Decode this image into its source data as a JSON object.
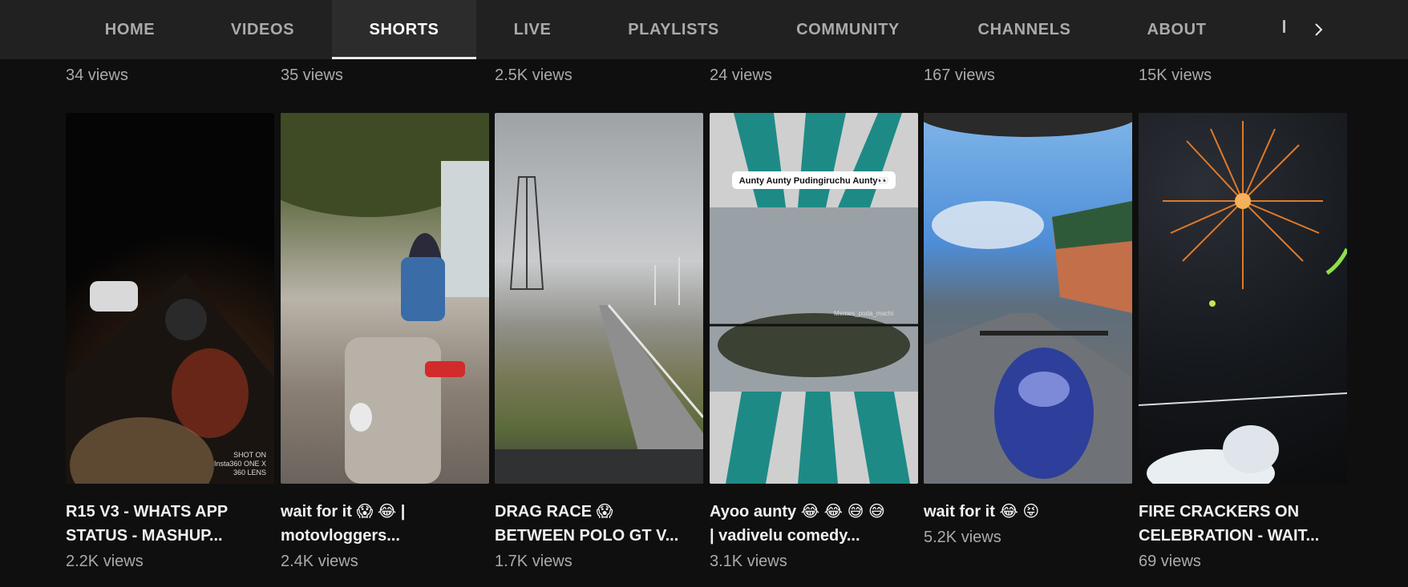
{
  "tabs": [
    {
      "label": "HOME",
      "active": false
    },
    {
      "label": "VIDEOS",
      "active": false
    },
    {
      "label": "SHORTS",
      "active": true
    },
    {
      "label": "LIVE",
      "active": false
    },
    {
      "label": "PLAYLISTS",
      "active": false
    },
    {
      "label": "COMMUNITY",
      "active": false
    },
    {
      "label": "CHANNELS",
      "active": false
    },
    {
      "label": "ABOUT",
      "active": false
    }
  ],
  "top_row": [
    "34 views",
    "35 views",
    "2.5K views",
    "24 views",
    "167 views",
    "15K views"
  ],
  "shorts": [
    {
      "title": "R15 V3 - WHATS APP\nSTATUS - MASHUP...",
      "views": "2.2K views",
      "watermark": "SHOT ON\nInsta360 ONE X\n360 LENS"
    },
    {
      "title": "wait for it 😱 😂 |\nmotovloggers...",
      "views": "2.4K views"
    },
    {
      "title": "DRAG RACE 😱\nBETWEEN POLO GT V...",
      "views": "1.7K views"
    },
    {
      "title": "Ayoo aunty 😂 😂 😅 😅\n| vadivelu comedy...",
      "views": "3.1K views",
      "caption": "Aunty Aunty Pudingiruchu Aunty👀",
      "watermark": "Memes_poda_machi"
    },
    {
      "title": "wait for it 😂 😝",
      "views": "5.2K views"
    },
    {
      "title": "FIRE CRACKERS ON\nCELEBRATION - WAIT...",
      "views": "69 views"
    }
  ],
  "icons": {
    "next": "chevron-right-icon"
  }
}
